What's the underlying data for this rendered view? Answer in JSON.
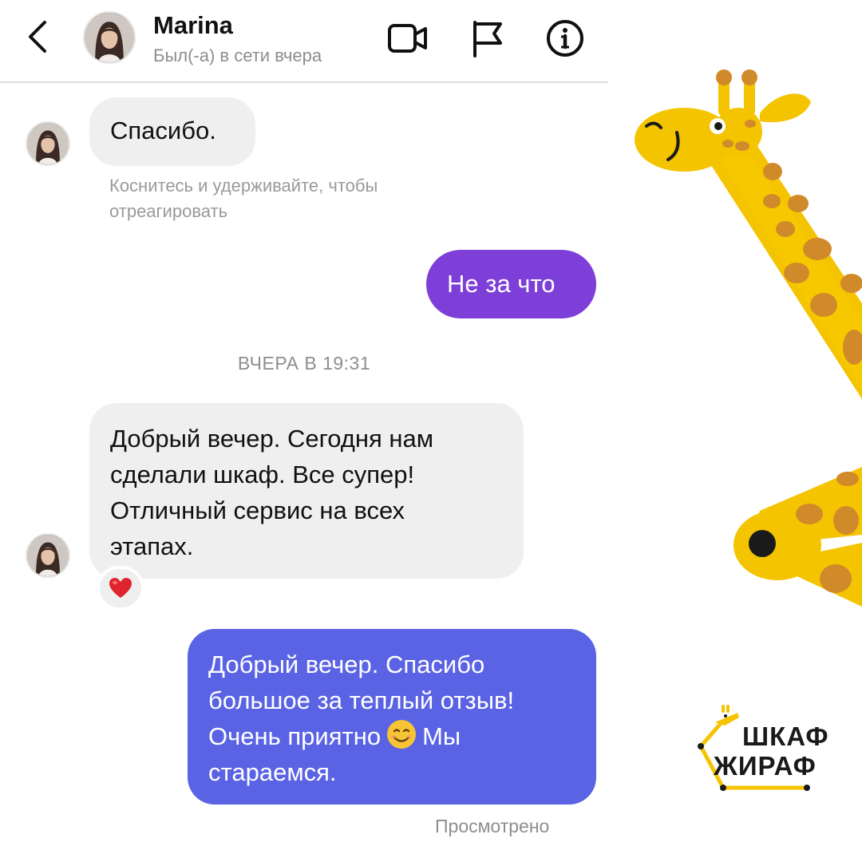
{
  "header": {
    "back_icon": "chevron-left-icon",
    "contact_name": "Marina",
    "contact_status": "Был(-а) в сети вчера",
    "icons": [
      "video-call-icon",
      "flag-icon",
      "info-icon"
    ]
  },
  "messages": [
    {
      "direction": "incoming",
      "text": "Спасибо."
    },
    {
      "direction": "outgoing",
      "text": "Не за что"
    },
    {
      "direction": "incoming",
      "lines": [
        "Добрый вечер. Сегодня нам",
        "сделали шкаф. Все супер!",
        "Отличный сервис на всех",
        "этапах."
      ],
      "reaction": "heart-emoji"
    },
    {
      "direction": "outgoing",
      "lines": [
        "Добрый вечер. Спасибо",
        "большое за теплый отзыв!",
        "Очень приятно",
        "Мы",
        "стараемся."
      ],
      "emoji": "smiling-face-emoji"
    }
  ],
  "hint_text": "Коснитесь и удерживайте, чтобы отреагировать",
  "timestamp": "ВЧЕРА В 19:31",
  "seen_status": "Просмотрено",
  "brand": {
    "line1": "ШКАФ",
    "line2": "ЖИРАФ",
    "mascot": "giraffe"
  },
  "colors": {
    "outgoing_purple": "#7d3fd8",
    "outgoing_blue": "#5a63e4",
    "incoming_bg": "#efefef",
    "giraffe_yellow": "#f5c400",
    "giraffe_spot": "#d08a2a"
  }
}
